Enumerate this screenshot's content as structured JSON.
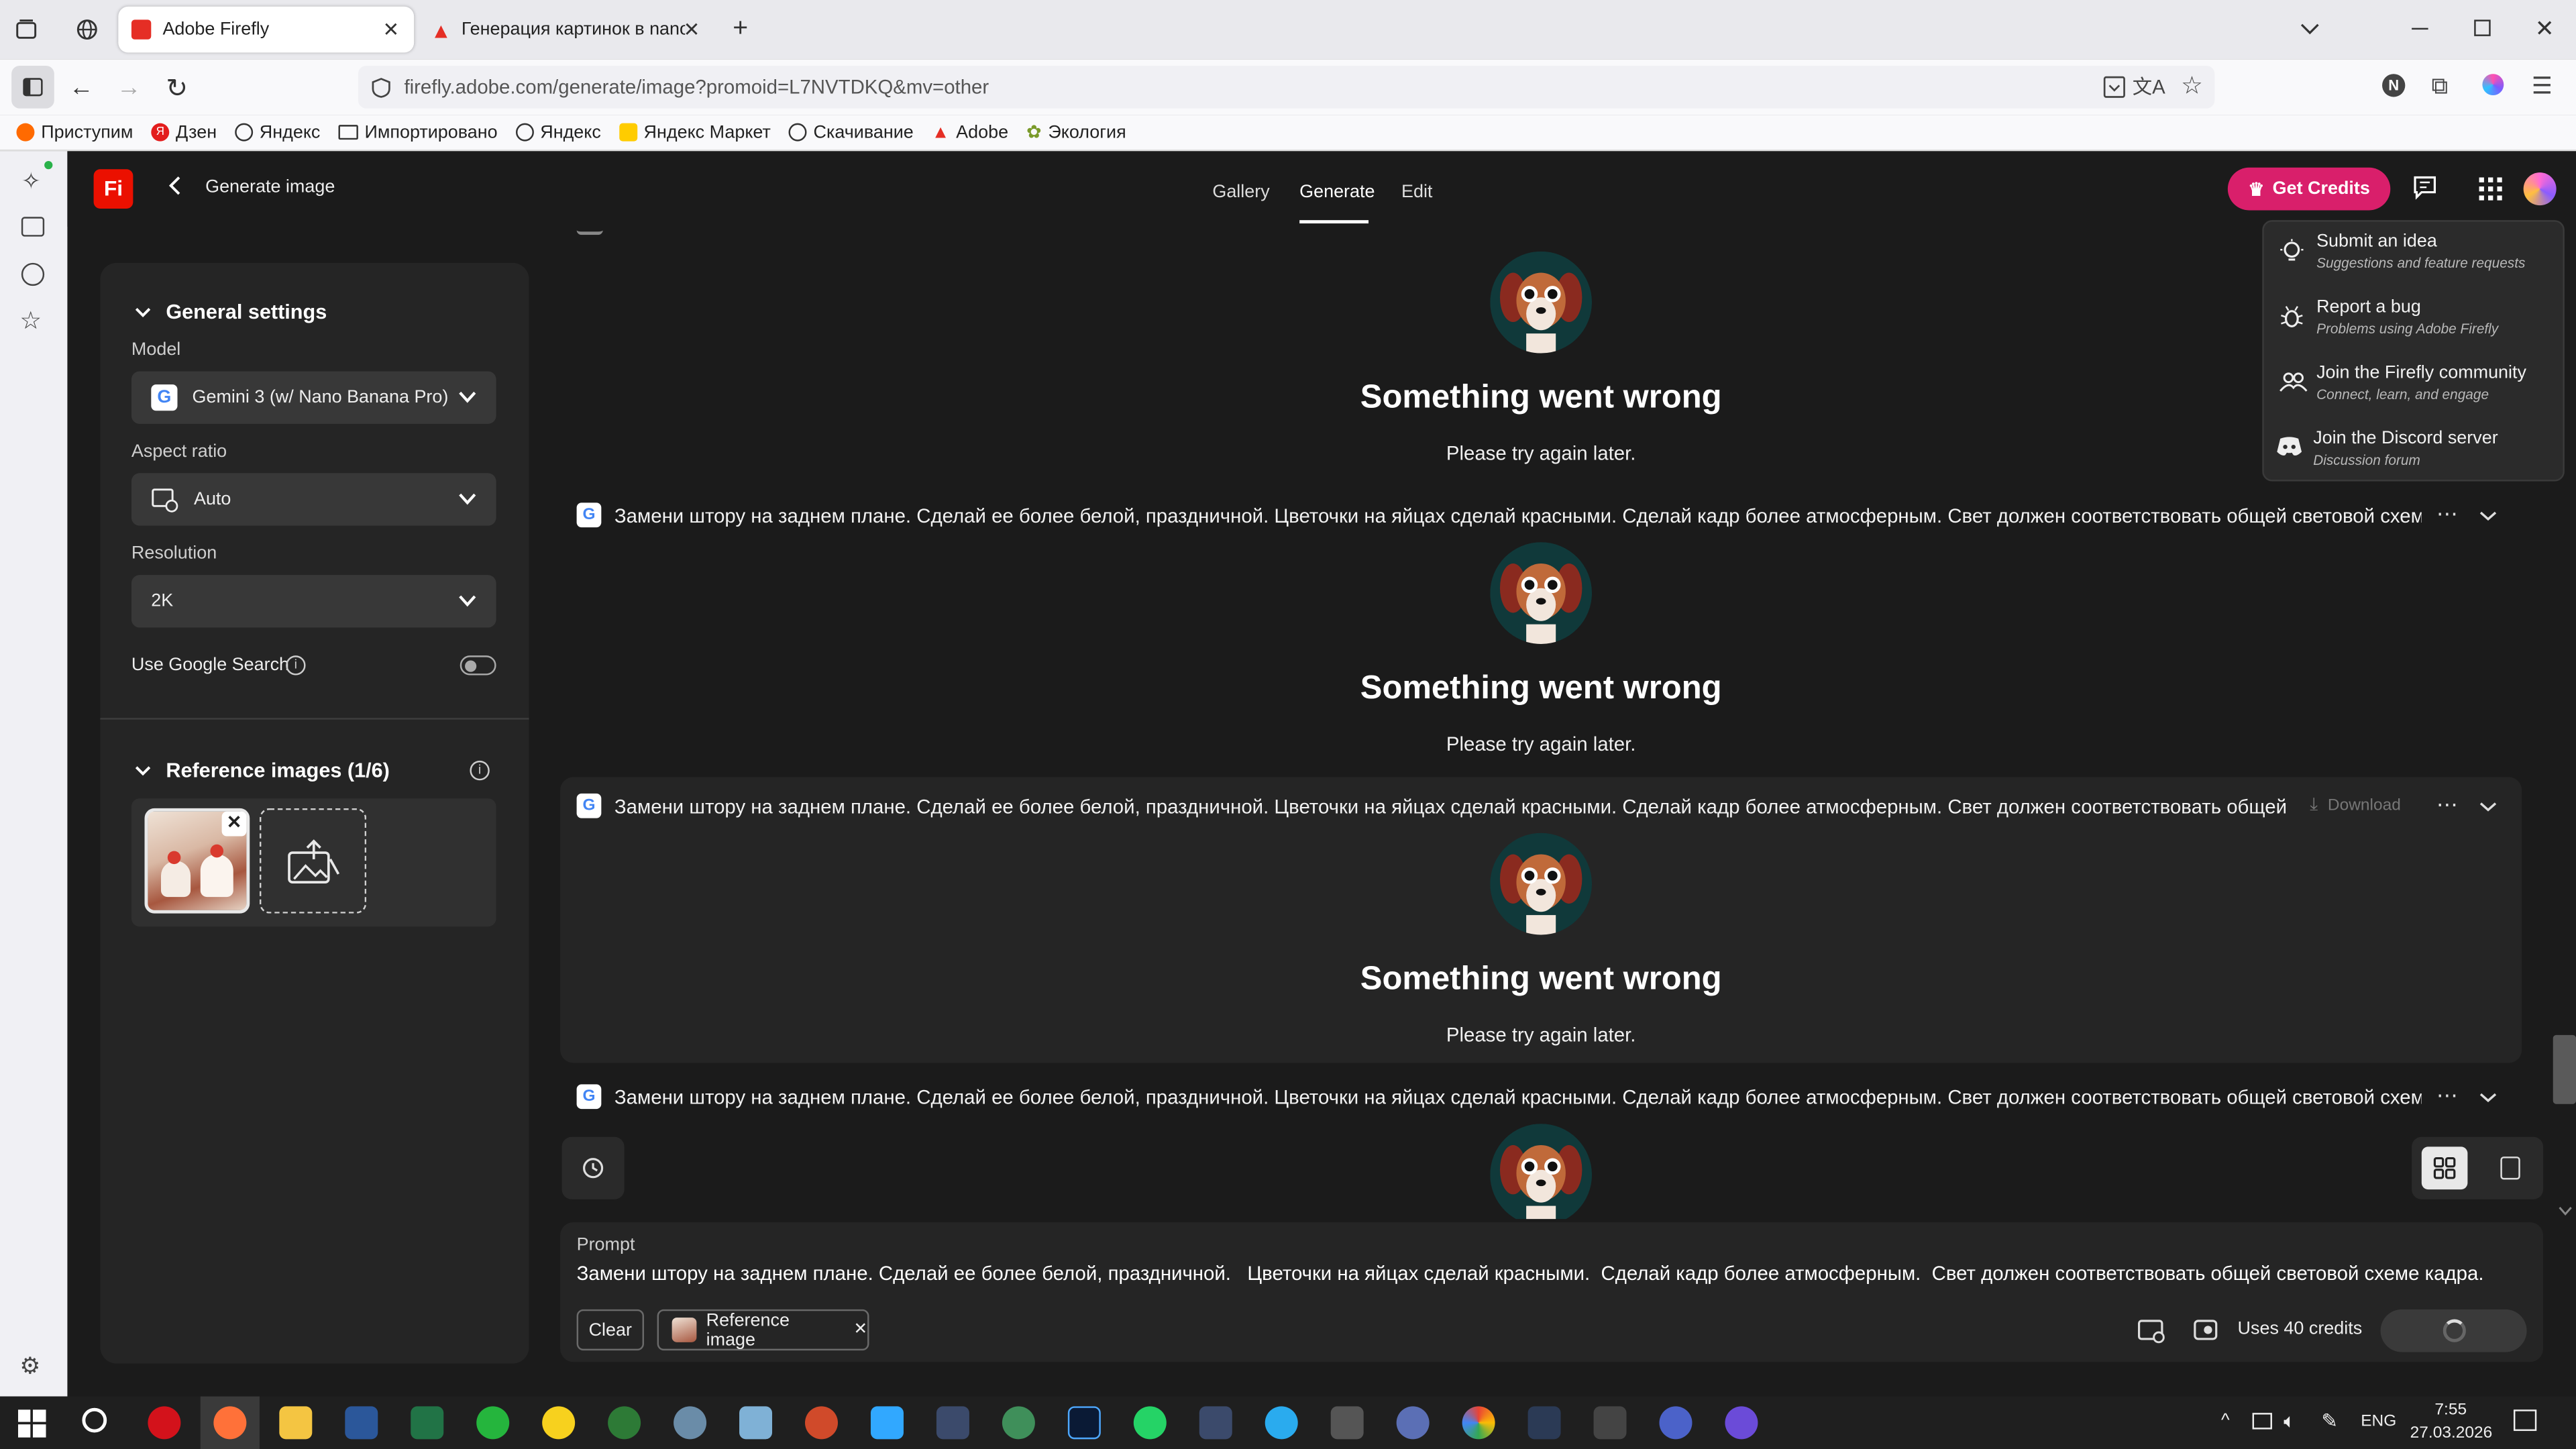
{
  "browser": {
    "tabs": [
      {
        "title": "Adobe Firefly"
      },
      {
        "title": "Генерация картинок в nano Ba"
      }
    ],
    "url": "firefly.adobe.com/generate/image?promoid=L7NVTDKQ&mv=other",
    "profile_letter": "N",
    "bookmarks": [
      "Приступим",
      "Дзен",
      "Яндекс",
      "Импортировано",
      "Яндекс",
      "Яндекс Маркет",
      "Скачивание",
      "Adobe",
      "Экология"
    ]
  },
  "app": {
    "logo": "Fi",
    "back_title": "Generate image",
    "nav": [
      "Gallery",
      "Generate",
      "Edit"
    ],
    "active_nav": "Generate",
    "get_credits": "Get Credits"
  },
  "settings": {
    "general_title": "General settings",
    "model_label": "Model",
    "model_value": "Gemini 3 (w/ Nano Banana Pro)",
    "aspect_label": "Aspect ratio",
    "aspect_value": "Auto",
    "resolution_label": "Resolution",
    "resolution_value": "2K",
    "google_search_label": "Use Google Search",
    "reference_title": "Reference images (1/6)"
  },
  "feed": {
    "prompt_text_1": "Замени штору на заднем плане. Сделай ее более белой, праздничной. Цветочки на яйцах сделай красными. Сделай кадр более атмосферным. Свет должен соответствовать общей световой схеме к",
    "prompt_text_2": "Замени штору на заднем плане. Сделай ее более белой, праздничной. Цветочки на яйцах сделай красными. Сделай кадр более атмосферным. Свет должен соответствовать общей св",
    "download": "Download",
    "error_title": "Something went wrong",
    "error_sub": "Please try again later."
  },
  "menu": [
    {
      "title": "Submit an idea",
      "sub": "Suggestions and feature requests"
    },
    {
      "title": "Report a bug",
      "sub": "Problems using Adobe Firefly"
    },
    {
      "title": "Join the Firefly community",
      "sub": "Connect, learn, and engage"
    },
    {
      "title": "Join the Discord server",
      "sub": "Discussion forum"
    }
  ],
  "prompt": {
    "label": "Prompt",
    "text": "Замени штору на заднем плане. Сделай ее более белой, праздничной.   Цветочки на яйцах сделай красными.  Сделай кадр более атмосферным.  Свет должен соответствовать общей световой схеме кадра.",
    "clear": "Clear",
    "reference_chip": "Reference image",
    "credits": "Uses 40 credits"
  },
  "taskbar": {
    "lang": "ENG",
    "time": "7:55",
    "date": "27.03.2026"
  }
}
